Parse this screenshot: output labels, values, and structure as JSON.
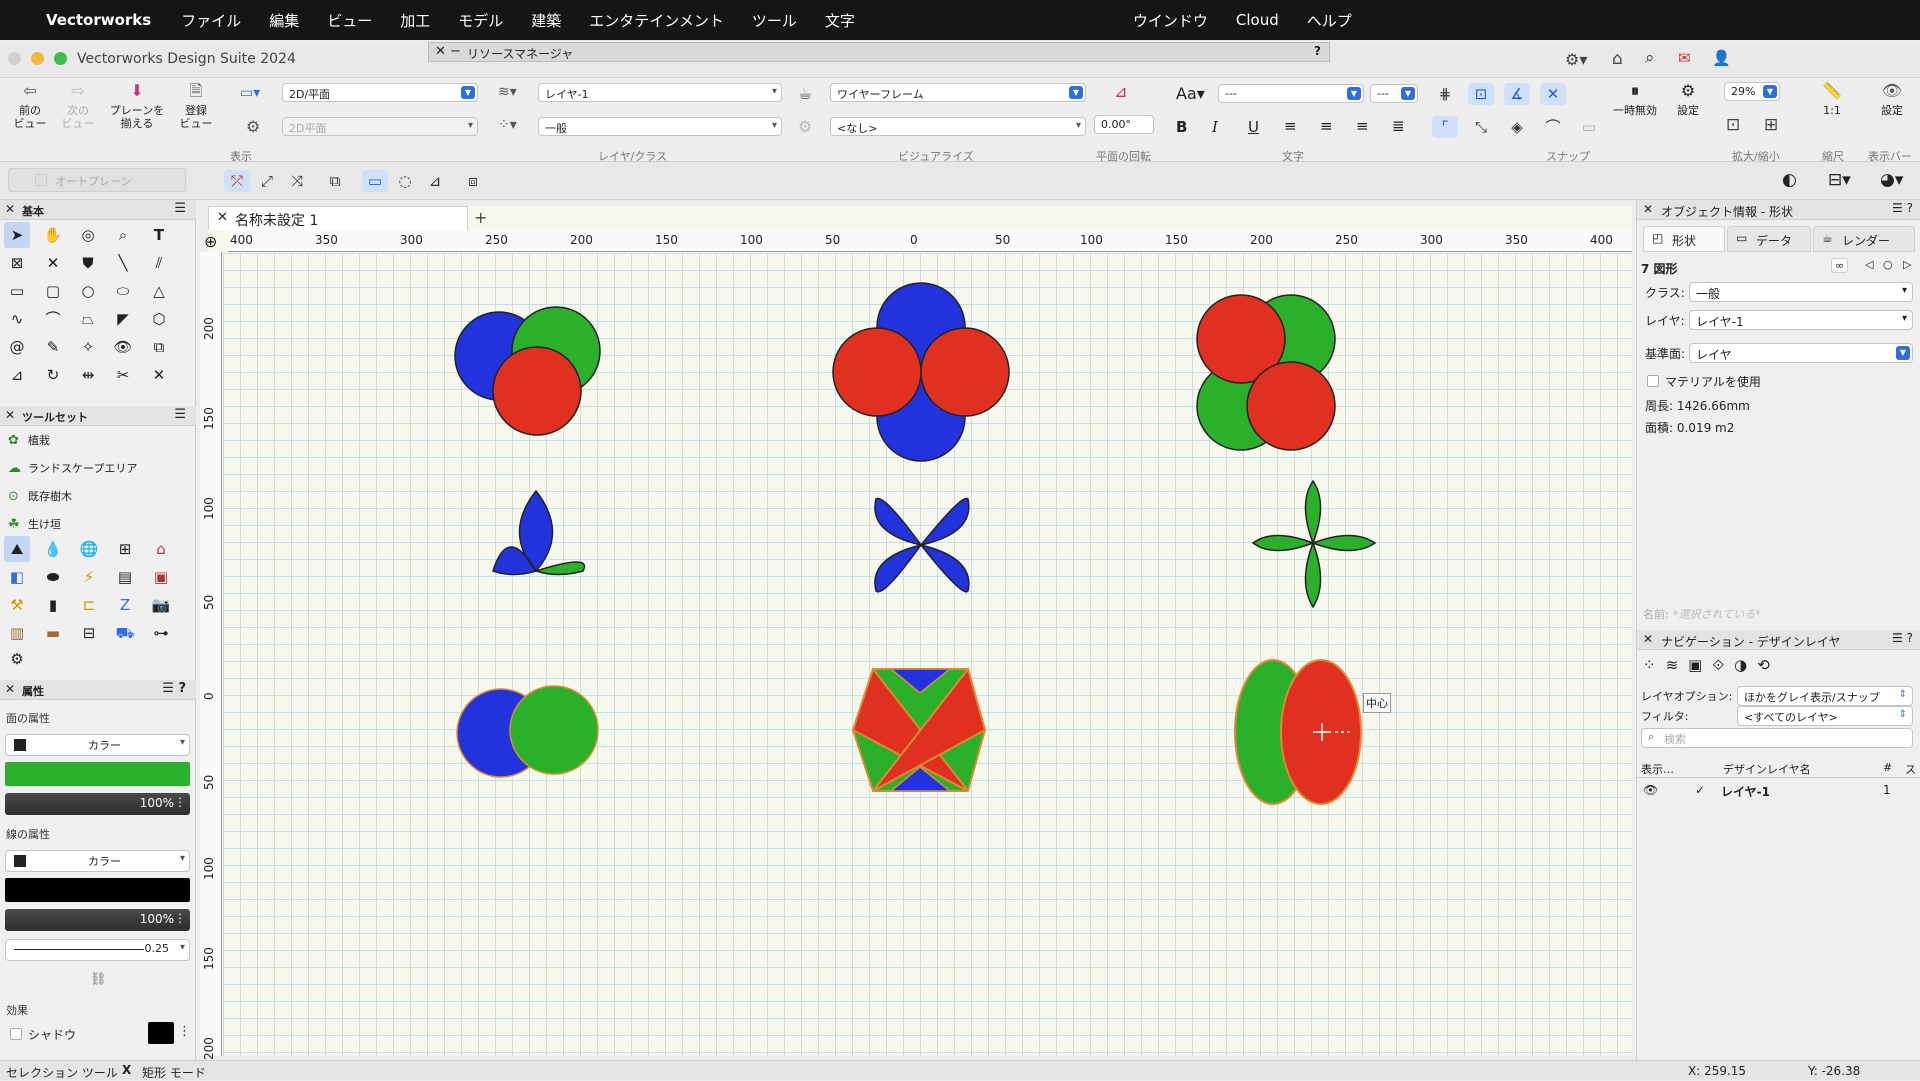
{
  "menubar": {
    "app": "Vectorworks",
    "items": [
      "ファイル",
      "編集",
      "ビュー",
      "加工",
      "モデル",
      "建築",
      "エンタテインメント",
      "ツール",
      "文字"
    ],
    "right_items": [
      "ウインドウ",
      "Cloud",
      "ヘルプ"
    ]
  },
  "window": {
    "title": "Vectorworks Design Suite 2024",
    "resource_manager": "リソースマネージャ",
    "help": "?"
  },
  "toolbar": {
    "prev_view": "前の\nビュー",
    "next_view": "次の\nビュー",
    "align_plane": "プレーンを\n揃える",
    "saved_view": "登録\nビュー",
    "view_dd": "2D/平面",
    "plane_dd": "2D平面",
    "layer_dd": "レイヤ-1",
    "class_dd": "一般",
    "render_dd": "ワイヤーフレーム",
    "none_dd": "<なし>",
    "rotation": "0.00°",
    "font_dd": "---",
    "size_dd": "---",
    "pause": "一時無効",
    "settings": "設定",
    "zoom": "29%",
    "scale": "1:1",
    "settings2": "設定",
    "groups": {
      "view": "表示",
      "layer_class": "レイヤ/クラス",
      "visualize": "ビジュアライズ",
      "plane_rotation": "平面の回転",
      "text": "文字",
      "snap": "スナップ",
      "zoom": "拡大/縮小",
      "scale": "縮尺",
      "display_bar": "表示バー"
    },
    "autoplane": "オートプレーン",
    "bold": "B",
    "italic": "I",
    "underline": "U"
  },
  "left": {
    "basic_header": "基本",
    "toolset_header": "ツールセット",
    "toolsets": [
      "植栽",
      "ランドスケープエリア",
      "既存樹木",
      "生け垣"
    ],
    "attr_header": "属性",
    "fill_label": "面の属性",
    "fill_type": "カラー",
    "fill_color": "#2bb02b",
    "fill_opacity": "100%",
    "line_label": "線の属性",
    "line_type": "カラー",
    "line_color": "#000000",
    "line_opacity": "100%",
    "line_weight": "0.25",
    "effects_label": "効果",
    "shadow_label": "シャドウ"
  },
  "document": {
    "tab": "名称未設定 1",
    "plus": "+",
    "ruler_h": [
      "400",
      "350",
      "300",
      "250",
      "200",
      "150",
      "100",
      "50",
      "0",
      "50",
      "100",
      "150",
      "200",
      "250",
      "300",
      "350",
      "400"
    ],
    "ruler_v": [
      "200",
      "150",
      "100",
      "50",
      "0",
      "50",
      "100",
      "150",
      "200"
    ],
    "center_label": "中心"
  },
  "info": {
    "header": "オブジェクト情報 - 形状",
    "tabs": [
      "形状",
      "データ",
      "レンダー"
    ],
    "count": "7 図形",
    "class_label": "クラス:",
    "class_value": "一般",
    "layer_label": "レイヤ:",
    "layer_value": "レイヤ-1",
    "plane_label": "基準面:",
    "plane_value": "レイヤ",
    "material_label": "マテリアルを使用",
    "perimeter": "周長:  1426.66mm",
    "area": "面積:  0.019 m2",
    "name_label": "名前:",
    "name_placeholder": "*選択されている*"
  },
  "nav": {
    "header": "ナビゲーション - デザインレイヤ",
    "layer_options_label": "レイヤオプション:",
    "layer_options_value": "ほかをグレイ表示/スナップ",
    "filter_label": "フィルタ:",
    "filter_value": "<すべてのレイヤ>",
    "search_placeholder": "検索",
    "col_show": "表示…",
    "col_name": "デザインレイヤ名",
    "col_num": "#",
    "col_s": "ス",
    "rows": [
      {
        "name": "レイヤ-1",
        "num": "1"
      }
    ]
  },
  "status": {
    "tool": "セレクション ツール",
    "mode": "矩形 モード",
    "x": "X: 259.15",
    "y": "Y: -26.38"
  },
  "colors": {
    "blue": "#2233dd",
    "red": "#e03020",
    "green": "#2bb02b",
    "accent": "#2e6fe0"
  }
}
